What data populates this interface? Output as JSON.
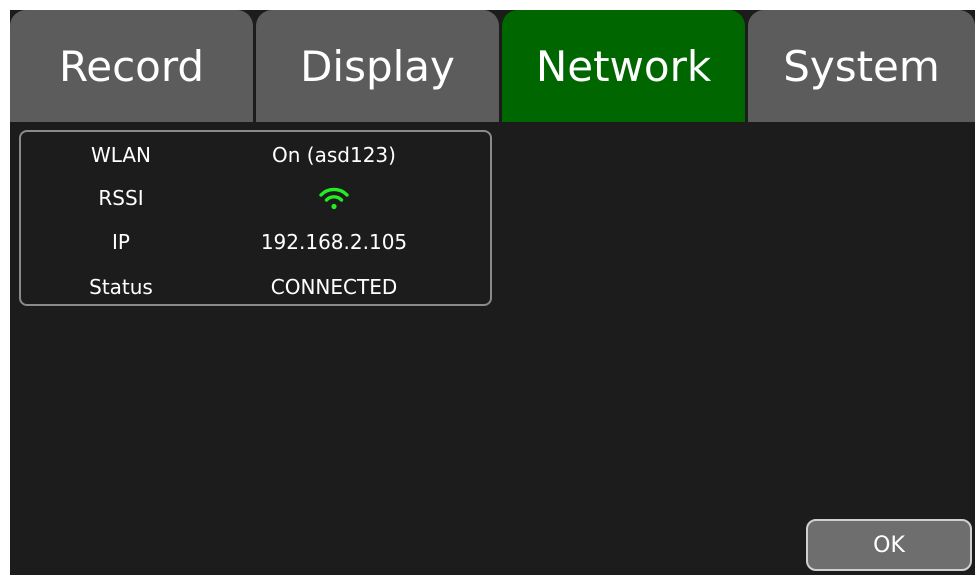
{
  "tabs": [
    {
      "label": "Record",
      "active": false
    },
    {
      "label": "Display",
      "active": false
    },
    {
      "label": "Network",
      "active": true
    },
    {
      "label": "System",
      "active": false
    }
  ],
  "network_info": {
    "wlan": {
      "label": "WLAN",
      "value": "On (asd123)"
    },
    "rssi": {
      "label": "RSSI",
      "icon": "wifi-signal-icon"
    },
    "ip": {
      "label": "IP",
      "value": "192.168.2.105"
    },
    "status": {
      "label": "Status",
      "value": "CONNECTED"
    }
  },
  "ok_button": {
    "label": "OK"
  },
  "colors": {
    "active_tab": "#006600",
    "inactive_tab": "#5c5c5c",
    "background": "#1c1c1c",
    "wifi_signal": "#22ee22"
  }
}
